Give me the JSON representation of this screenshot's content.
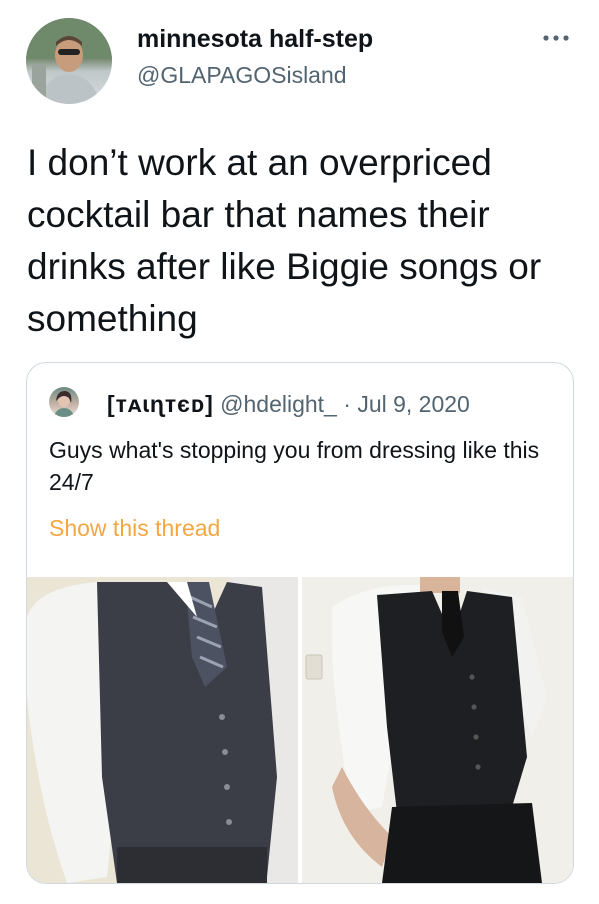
{
  "author": {
    "display_name": "minnesota half-step",
    "handle": "@GLAPAGOSisland"
  },
  "tweet": {
    "text": "I don’t work at an overpriced cocktail bar that names their drinks after like Biggie songs or something"
  },
  "quoted_tweet": {
    "display_name": "[ᴛᴀɩɳᴛєᴅ]",
    "handle": "@hdelight_",
    "separator": "·",
    "date": "Jul 9, 2020",
    "text": "Guys what's stopping you from dressing like this 24/7",
    "show_thread_label": "Show this thread",
    "photos": [
      "photo-vest-gray-striped-tie",
      "photo-vest-black-tie"
    ]
  },
  "icons": {
    "more": "more-horizontal-icon"
  },
  "colors": {
    "text_primary": "#0f1419",
    "text_secondary": "#536471",
    "link_accent": "#f4a642",
    "card_border": "#cfd9de"
  }
}
